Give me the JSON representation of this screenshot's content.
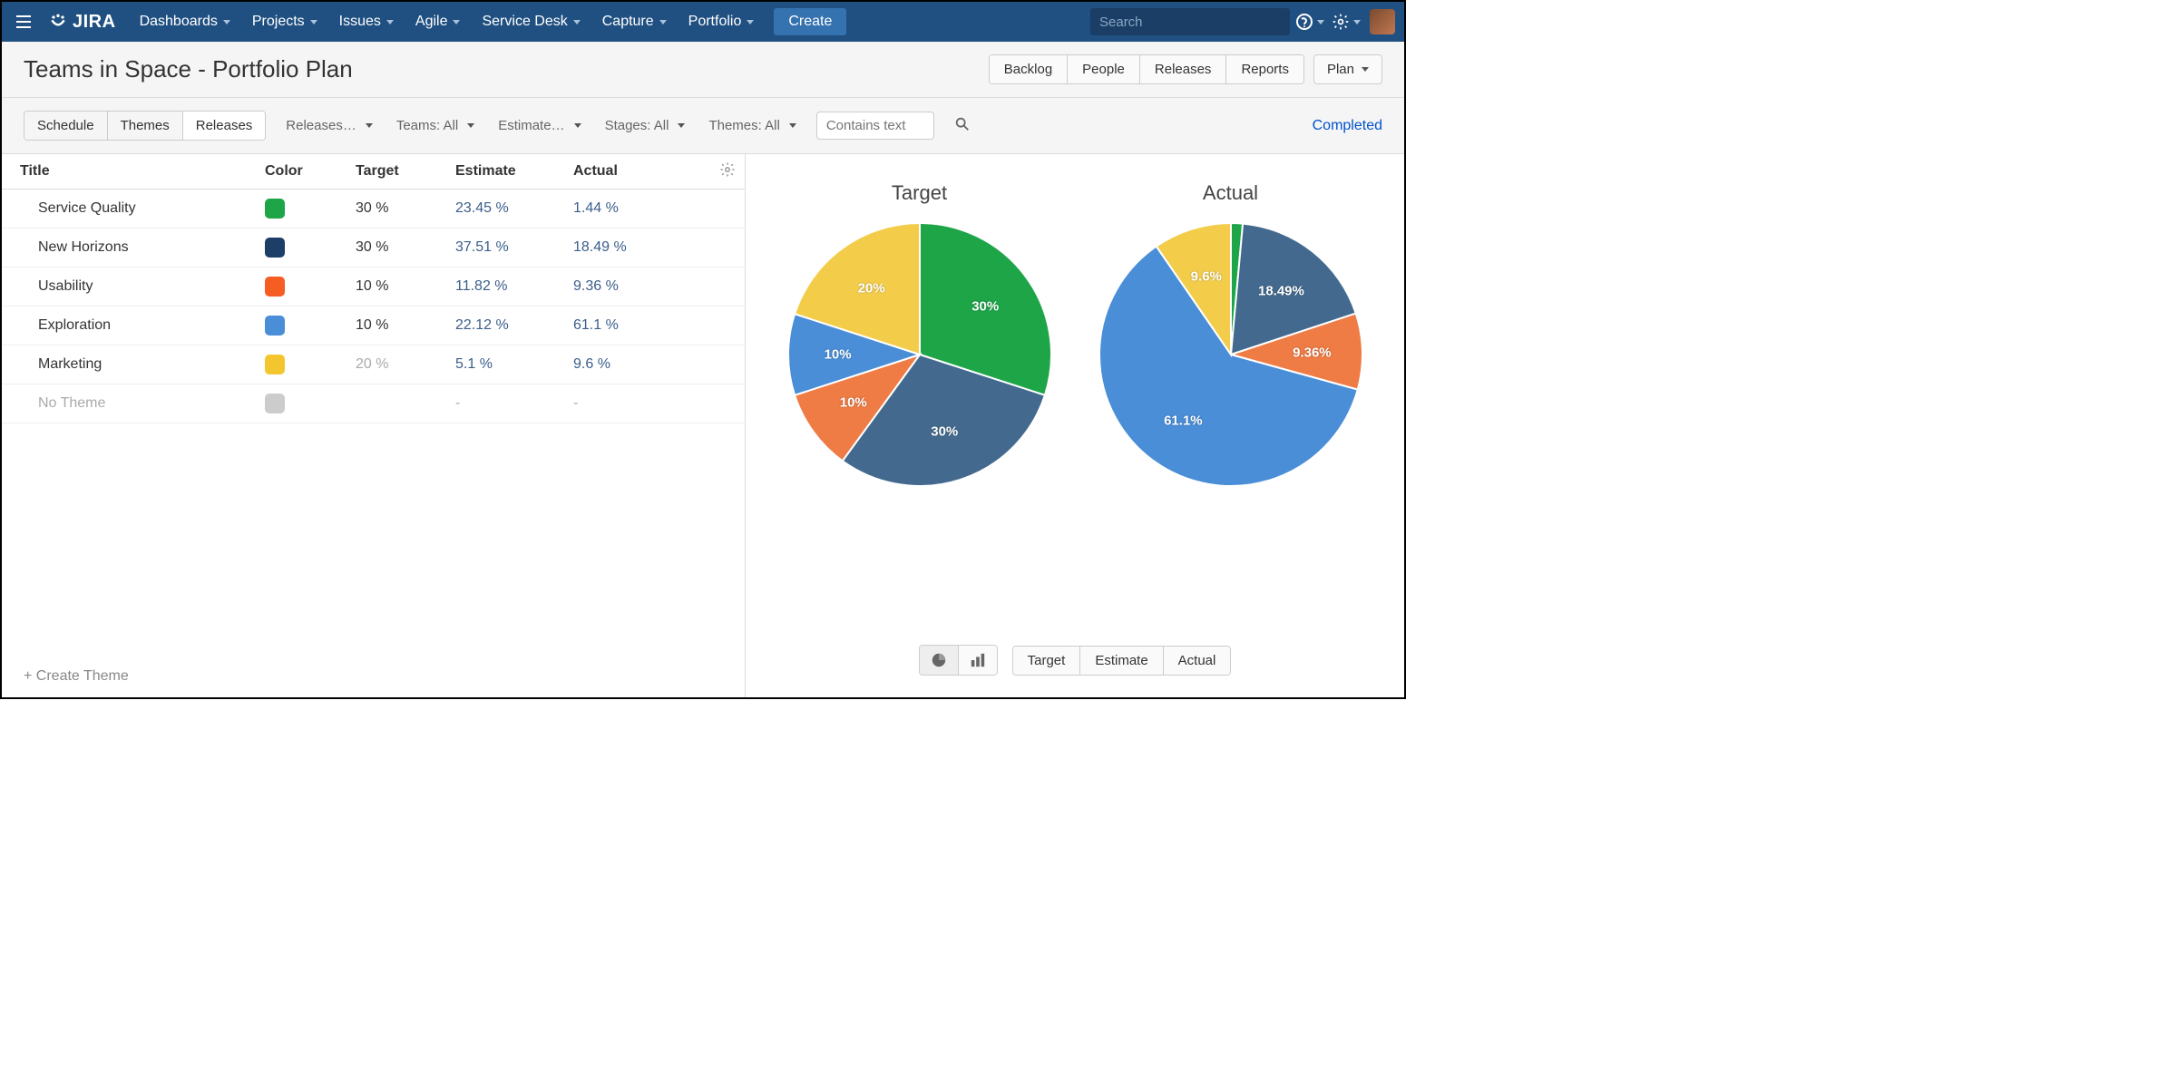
{
  "nav": {
    "brand": "JIRA",
    "items": [
      "Dashboards",
      "Projects",
      "Issues",
      "Agile",
      "Service Desk",
      "Capture",
      "Portfolio"
    ],
    "create": "Create",
    "search_placeholder": "Search"
  },
  "page": {
    "title": "Teams in Space - Portfolio Plan",
    "tabs": [
      "Backlog",
      "People",
      "Releases",
      "Reports"
    ],
    "plan_menu": "Plan"
  },
  "toolbar": {
    "segments": [
      "Schedule",
      "Themes",
      "Releases"
    ],
    "active_segment_index": 2,
    "filters": {
      "releases": "Releases…",
      "teams": "Teams: All",
      "estimate": "Estimate…",
      "stages": "Stages: All",
      "themes": "Themes: All"
    },
    "text_filter_placeholder": "Contains text",
    "completed_link": "Completed"
  },
  "table": {
    "headers": {
      "title": "Title",
      "color": "Color",
      "target": "Target",
      "estimate": "Estimate",
      "actual": "Actual"
    },
    "rows": [
      {
        "title": "Service Quality",
        "color": "#1ea548",
        "target": "30 %",
        "estimate": "23.45 %",
        "actual": "1.44 %"
      },
      {
        "title": "New Horizons",
        "color": "#1c3e67",
        "target": "30 %",
        "estimate": "37.51 %",
        "actual": "18.49 %"
      },
      {
        "title": "Usability",
        "color": "#f55d22",
        "target": "10 %",
        "estimate": "11.82 %",
        "actual": "9.36 %"
      },
      {
        "title": "Exploration",
        "color": "#4a8ed8",
        "target": "10 %",
        "estimate": "22.12 %",
        "actual": "61.1 %"
      },
      {
        "title": "Marketing",
        "color": "#f3c62f",
        "target": "20 %",
        "target_muted": true,
        "estimate": "5.1 %",
        "actual": "9.6 %"
      },
      {
        "title": "No Theme",
        "color": "#cccccc",
        "muted": true,
        "target": "",
        "estimate": "-",
        "actual": "-"
      }
    ],
    "create_theme": "+ Create Theme"
  },
  "chart_controls": {
    "metrics": [
      "Target",
      "Estimate",
      "Actual"
    ]
  },
  "chart_data": [
    {
      "type": "pie",
      "title": "Target",
      "series": [
        {
          "name": "Service Quality",
          "value": 30,
          "label": "30%",
          "color": "#1ea548"
        },
        {
          "name": "New Horizons",
          "value": 30,
          "label": "30%",
          "color": "#436a8e"
        },
        {
          "name": "Usability",
          "value": 10,
          "label": "10%",
          "color": "#ef7b45"
        },
        {
          "name": "Exploration",
          "value": 10,
          "label": "10%",
          "color": "#4a8ed8"
        },
        {
          "name": "Marketing",
          "value": 20,
          "label": "20%",
          "color": "#f3cd4a"
        }
      ]
    },
    {
      "type": "pie",
      "title": "Actual",
      "series": [
        {
          "name": "Service Quality",
          "value": 1.44,
          "label": "",
          "color": "#1ea548"
        },
        {
          "name": "New Horizons",
          "value": 18.49,
          "label": "18.49%",
          "color": "#436a8e"
        },
        {
          "name": "Usability",
          "value": 9.36,
          "label": "9.36%",
          "color": "#ef7b45"
        },
        {
          "name": "Exploration",
          "value": 61.1,
          "label": "61.1%",
          "color": "#4a8ed8"
        },
        {
          "name": "Marketing",
          "value": 9.6,
          "label": "9.6%",
          "color": "#f3cd4a"
        }
      ]
    }
  ]
}
